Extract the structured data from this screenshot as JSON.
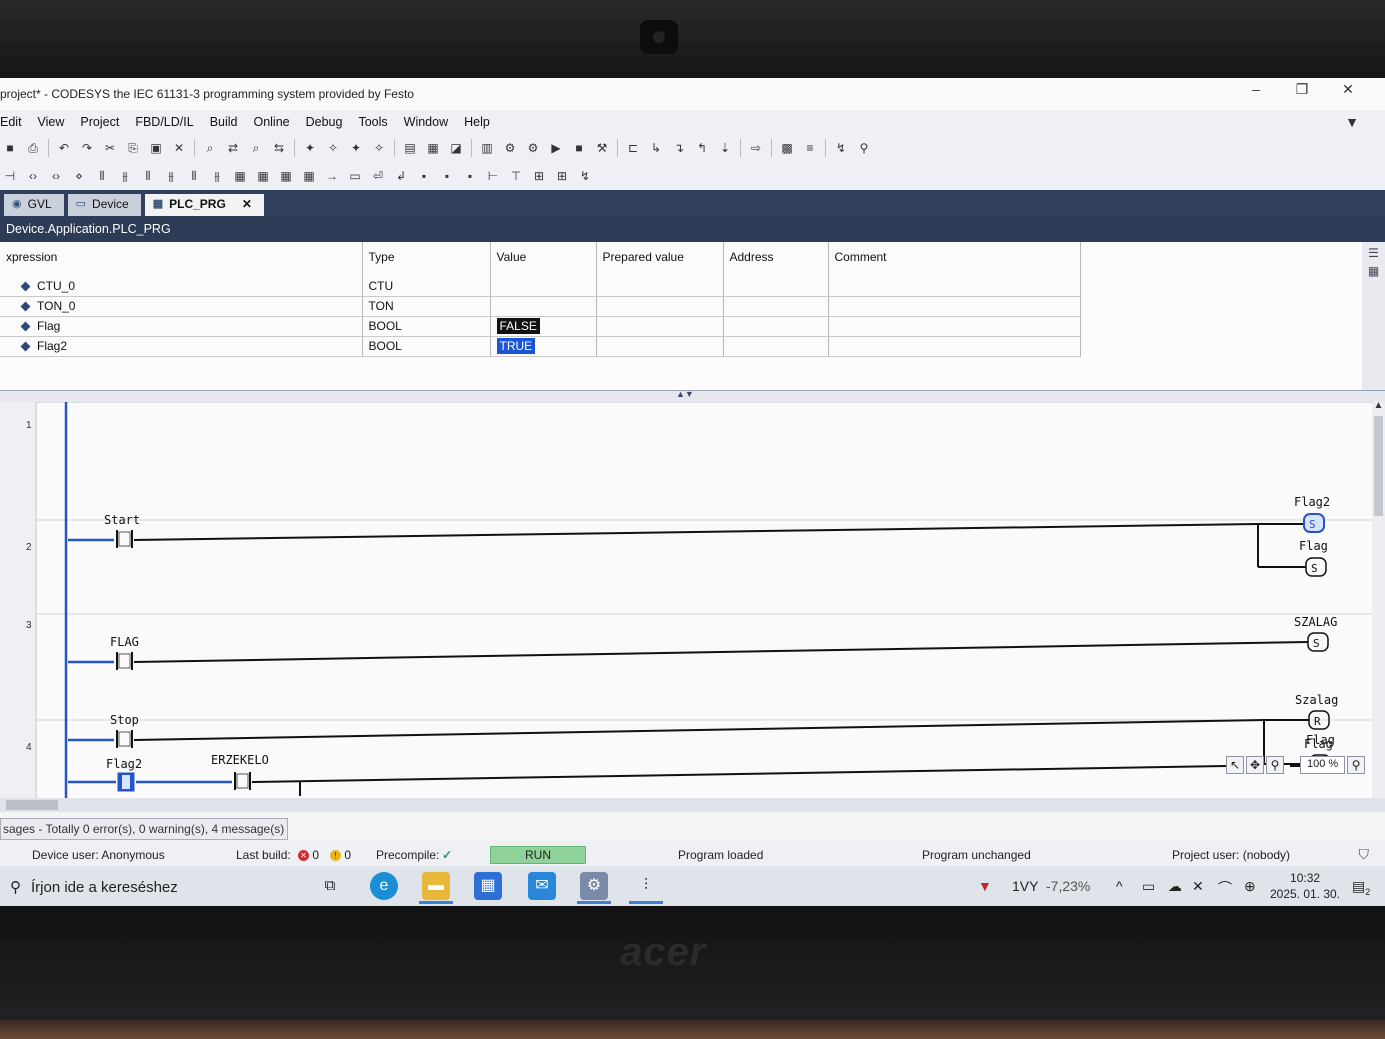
{
  "window": {
    "title": "project* - CODESYS the IEC 61131-3 programming system provided by Festo",
    "controls": [
      "–",
      "❐",
      "✕"
    ]
  },
  "menu": [
    "Edit",
    "View",
    "Project",
    "FBD/LD/IL",
    "Build",
    "Online",
    "Debug",
    "Tools",
    "Window",
    "Help"
  ],
  "tabs": [
    {
      "label": "GVL",
      "icon": "gvl-icon"
    },
    {
      "label": "Device",
      "icon": "device-icon"
    },
    {
      "label": "PLC_PRG",
      "icon": "program-icon",
      "active": true,
      "close": "✕"
    }
  ],
  "path": "Device.Application.PLC_PRG",
  "vartable": {
    "headers": {
      "expression": "xpression",
      "type": "Type",
      "value": "Value",
      "prepared": "Prepared value",
      "address": "Address",
      "comment": "Comment"
    },
    "rows": [
      {
        "name": "CTU_0",
        "type": "CTU",
        "value": ""
      },
      {
        "name": "TON_0",
        "type": "TON",
        "value": ""
      },
      {
        "name": "Flag",
        "type": "BOOL",
        "value": "FALSE"
      },
      {
        "name": "Flag2",
        "type": "BOOL",
        "value": "TRUE"
      }
    ]
  },
  "ladder": {
    "rungs": [
      {
        "num": "1",
        "contact": "Start",
        "coils": [
          {
            "name": "Flag2",
            "kind": "S"
          },
          {
            "name": "Flag",
            "kind": "S"
          }
        ]
      },
      {
        "num": "2",
        "contact": "FLAG",
        "coils": [
          {
            "name": "SZALAG",
            "kind": "S"
          }
        ]
      },
      {
        "num": "3",
        "contact": "Stop",
        "coils": [
          {
            "name": "Szalag",
            "kind": "R"
          },
          {
            "name": "Flag",
            "kind": "R"
          }
        ]
      },
      {
        "num": "4",
        "contact": "Flag2",
        "contact2": "ERZEKELO",
        "coils": [
          {
            "name": "Flag",
            "kind": ""
          }
        ]
      }
    ],
    "zoom": "100 %"
  },
  "messages": "sages - Totally 0 error(s), 0 warning(s), 4 message(s)",
  "status": {
    "device_user": "Device user: Anonymous",
    "last_build": "Last build:",
    "errors": "0",
    "warnings": "0",
    "precompile": "Precompile:",
    "precompile_ok": "✓",
    "run": "RUN",
    "program_loaded": "Program loaded",
    "program_unchanged": "Program unchanged",
    "project_user": "Project user: (nobody)"
  },
  "taskbar": {
    "search_placeholder": "Írjon ide a kereséshez",
    "ticker": "1VY",
    "ticker_change": "-7,23%",
    "time": "10:32",
    "date": "2025. 01. 30.",
    "notifications": "2"
  },
  "brand": "acer"
}
